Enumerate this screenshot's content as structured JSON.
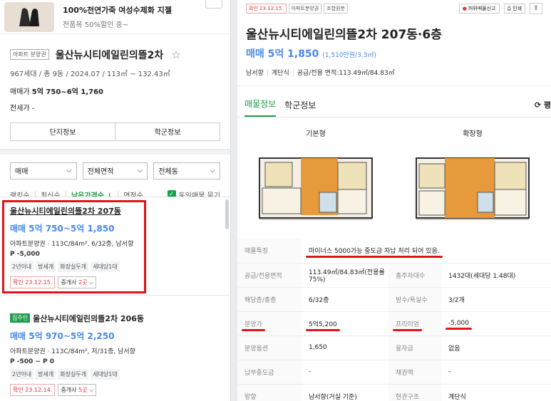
{
  "ad": {
    "title": "100%천연가죽 여성수제화 지젤",
    "subtitle": "전품목 50%할인 중~"
  },
  "complex": {
    "tag": "아파트 분양권",
    "name": "울산뉴시티에일린의뜰2차",
    "meta": "967세대 / 총 9동 / 2024.07 / 113㎡ ~ 132.43㎡",
    "price_label": "매매가",
    "price_value": "5억 750~6억 1,760",
    "jeonse": "전세가 -"
  },
  "buttons": {
    "complex_info": "단지정보",
    "school_info": "학군정보"
  },
  "filters": [
    {
      "label": "매매"
    },
    {
      "label": "전체면적"
    },
    {
      "label": "전체동"
    }
  ],
  "sort": {
    "items": [
      "랭킹순",
      "최신순",
      "낮은가격순 ↓",
      "면적순"
    ],
    "same_listing": "동일매물 묶기"
  },
  "listings": [
    {
      "title": "울산뉴시티에일린의뜰2차 207동",
      "price": "매매 5억 750~5억 1,850",
      "info": "아파트분양권 · 113C/84m², 6/32층, 남서향",
      "extra": "P -5,000",
      "chips": [
        "2년이내",
        "방세개",
        "화장실두개",
        "세대당1대"
      ],
      "confirm": "확인 23.12.15.",
      "broker_prefix": "중개사 ",
      "broker_count": "2곳"
    },
    {
      "badge": "집주인",
      "title": "울산뉴시티에일린의뜰2차 206동",
      "price": "매매 5억 970~5억 2,250",
      "info": "아파트분양권 · 113C/84m², 저/31층, 남서향",
      "extra": "P -500 ~ P 0",
      "chips": [
        "2년이내",
        "방세개",
        "화장실두개",
        "세대당1대"
      ],
      "confirm": "확인 23.12.14.",
      "broker_prefix": "중개사 ",
      "broker_count": "5곳"
    }
  ],
  "detail": {
    "tags": [
      "확인 23.12.15.",
      "아파트분양권",
      "조합원분"
    ],
    "report": "허위매물신고",
    "print": "인쇄",
    "title": "울산뉴시티에일린의뜰2차 207동·6층",
    "price": "매매 5억 1,850",
    "price_per": "(1,510만원/3.3㎡)",
    "direction": "남서향",
    "heating": "계단식",
    "area": "공급/전용 면적:113.49㎡/84.83㎡",
    "tabs": [
      "매물정보",
      "학군정보"
    ],
    "compare": "⟳ 평",
    "plans": [
      "기본형",
      "확장형"
    ],
    "specs": [
      {
        "k": "매물특징",
        "v": "마이너스 5000가능 중도금 자납 처리 되어 있음."
      },
      {
        "k": "공급/전용면적",
        "v": "113.49㎡/84.83㎡(전용률75%)",
        "k2": "총주차대수",
        "v2": "1432대(세대당 1.48대)"
      },
      {
        "k": "해당층/총층",
        "v": "6/32층",
        "k2": "방수/욕실수",
        "v2": "3/2개"
      },
      {
        "k": "분양가",
        "v": "5억5,200",
        "k2": "프리미엄",
        "v2": "-5,000"
      },
      {
        "k": "분양옵션",
        "v": "1,650",
        "k2": "융자금",
        "v2": "없음"
      },
      {
        "k": "납부중도금",
        "v": "-",
        "k2": "채권액",
        "v2": "-"
      },
      {
        "k": "방향",
        "v": "남서향(거실 기준)",
        "k2": "현관구조",
        "v2": "계단식"
      }
    ]
  }
}
